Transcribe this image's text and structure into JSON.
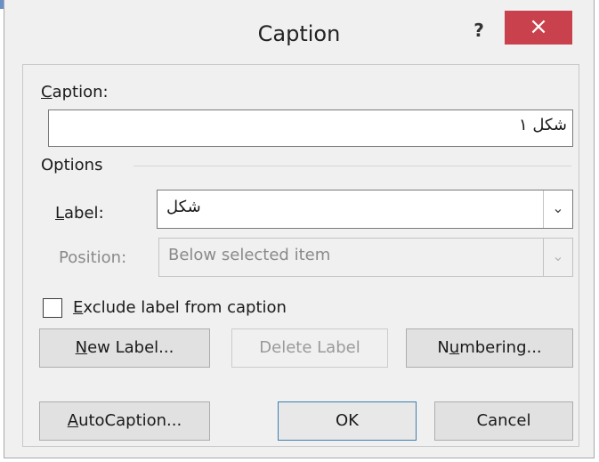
{
  "dialog": {
    "title": "Caption",
    "help_label": "?",
    "close_label": "×"
  },
  "caption": {
    "label_first": "C",
    "label_rest": "aption:",
    "value": "شکل ۱"
  },
  "options": {
    "heading": "Options",
    "label_field": {
      "label_first": "L",
      "label_rest": "abel:",
      "value": "شکل",
      "arrow": "⌄"
    },
    "position_field": {
      "label": "Position:",
      "value": "Below selected item",
      "arrow": "⌄"
    }
  },
  "exclude": {
    "label_first": "E",
    "label_rest": "xclude label from caption",
    "checked": false
  },
  "buttons": {
    "new_label_first": "N",
    "new_label_rest": "ew Label...",
    "delete_label": "Delete Label",
    "numbering_pre": "N",
    "numbering_u": "u",
    "numbering_rest": "mbering...",
    "autocaption_first": "A",
    "autocaption_rest": "utoCaption...",
    "ok": "OK",
    "cancel": "Cancel"
  }
}
